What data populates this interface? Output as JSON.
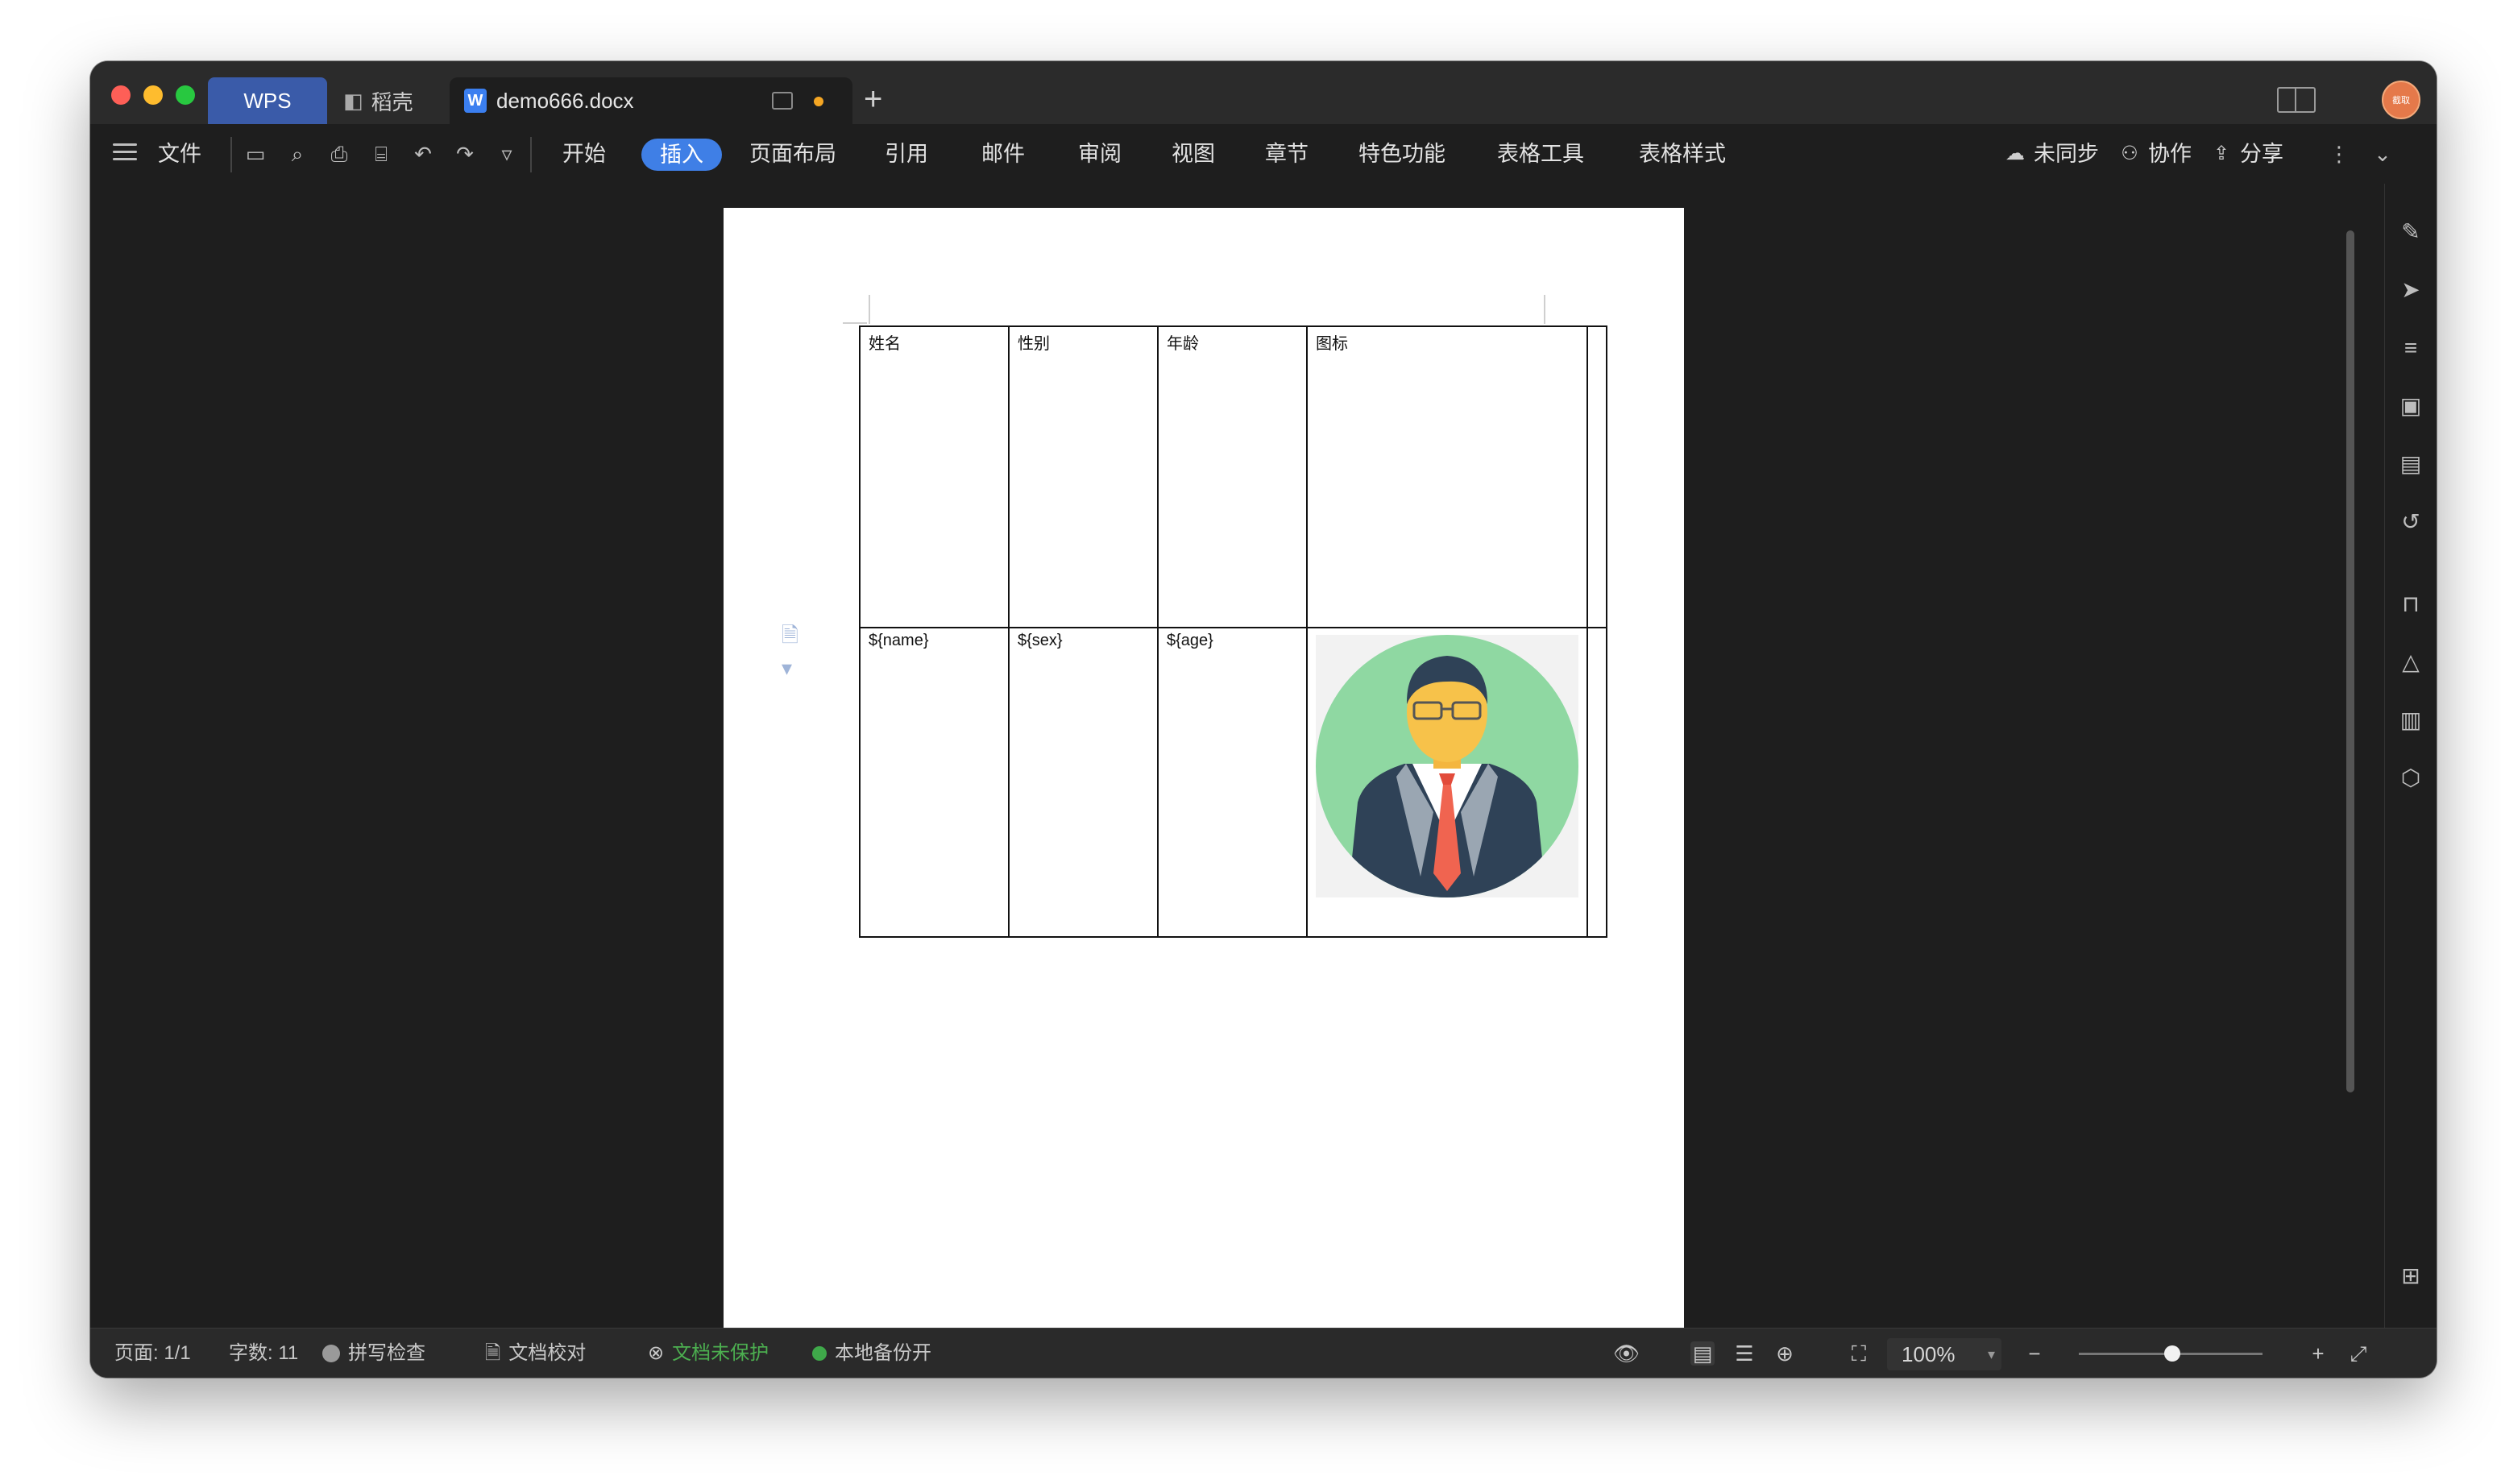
{
  "tabs": {
    "wps": "WPS",
    "daoke": "稻壳",
    "document": "demo666.docx"
  },
  "avatar_text": "截取",
  "menu": {
    "file": "文件",
    "tabs": [
      "开始",
      "插入",
      "页面布局",
      "引用",
      "邮件",
      "审阅",
      "视图",
      "章节",
      "特色功能",
      "表格工具",
      "表格样式"
    ],
    "active_tab": "插入",
    "right_actions": {
      "sync": "未同步",
      "collab": "协作",
      "share": "分享"
    }
  },
  "table": {
    "headers": [
      "姓名",
      "性别",
      "年龄",
      "图标"
    ],
    "row": [
      "${name}",
      "${sex}",
      "${age}"
    ]
  },
  "status": {
    "page": "页面: 1/1",
    "words": "字数: 11",
    "spell": "拼写检查",
    "proof": "文档校对",
    "protect": "文档未保护",
    "backup": "本地备份开",
    "zoom": "100%"
  },
  "colors": {
    "accent": "#3f7fe6",
    "wps_tab": "#3a5ba9",
    "protect_text": "#4caf50"
  }
}
